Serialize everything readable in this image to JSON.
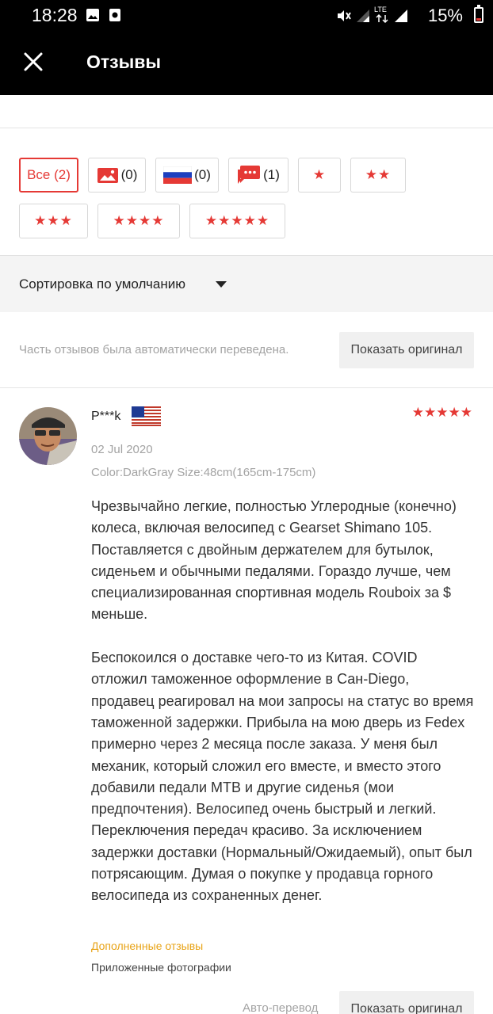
{
  "status_bar": {
    "time": "18:28",
    "battery": "15%",
    "icons": [
      "image-icon",
      "record-icon",
      "mute-icon",
      "signal-icon",
      "lte-icon",
      "signal-icon",
      "battery-icon"
    ]
  },
  "header": {
    "title": "Отзывы"
  },
  "filters": {
    "all_label": "Все (2)",
    "photo_count": "(0)",
    "country_count": "(0)",
    "comment_count": "(1)",
    "star_chips": [
      "★",
      "★★",
      "★★★",
      "★★★★",
      "★★★★★"
    ]
  },
  "sort": {
    "label": "Сортировка по умолчанию"
  },
  "notice": {
    "text": "Часть отзывов была автоматически переведена.",
    "button": "Показать оригинал"
  },
  "review": {
    "author": "P***k",
    "rating_stars": "★★★★★",
    "rating": 5,
    "date": "02 Jul 2020",
    "variant": "Color:DarkGray Size:48cm(165cm-175cm)",
    "text": "Чрезвычайно легкие, полностью Углеродные (конечно) колеса, включая велосипед с Gearset Shimano 105. Поставляется с двойным держателем для бутылок, сиденьем и обычными педалями. Гораздо лучше, чем специализированная спортивная модель Rouboix за $ меньше.\n\nБеспокоился о доставке чего-то из Китая. COVID отложил таможенное оформление в Сан-Diego, продавец реагировал на мои запросы на статус во время таможенной задержки. Прибыла на мою дверь из Fedex примерно через 2 месяца после заказа. У меня был механик, который сложил его вместе, и вместо этого добавили педали MTB и другие сиденья (мои предпочтения). Велосипед очень быстрый и легкий. Переключения передач красиво. За исключением задержки доставки (Нормальный/Ожидаемый), опыт был потрясающим. Думая о покупке у продавца горного велосипеда из сохраненных денег.",
    "additional_label": "Дополненные отзывы",
    "photos_label": "Приложенные фотографии",
    "auto_translate": "Авто-перевод",
    "show_original": "Показать оригинал"
  },
  "colors": {
    "accent": "#e53935",
    "amber": "#e8a317"
  }
}
